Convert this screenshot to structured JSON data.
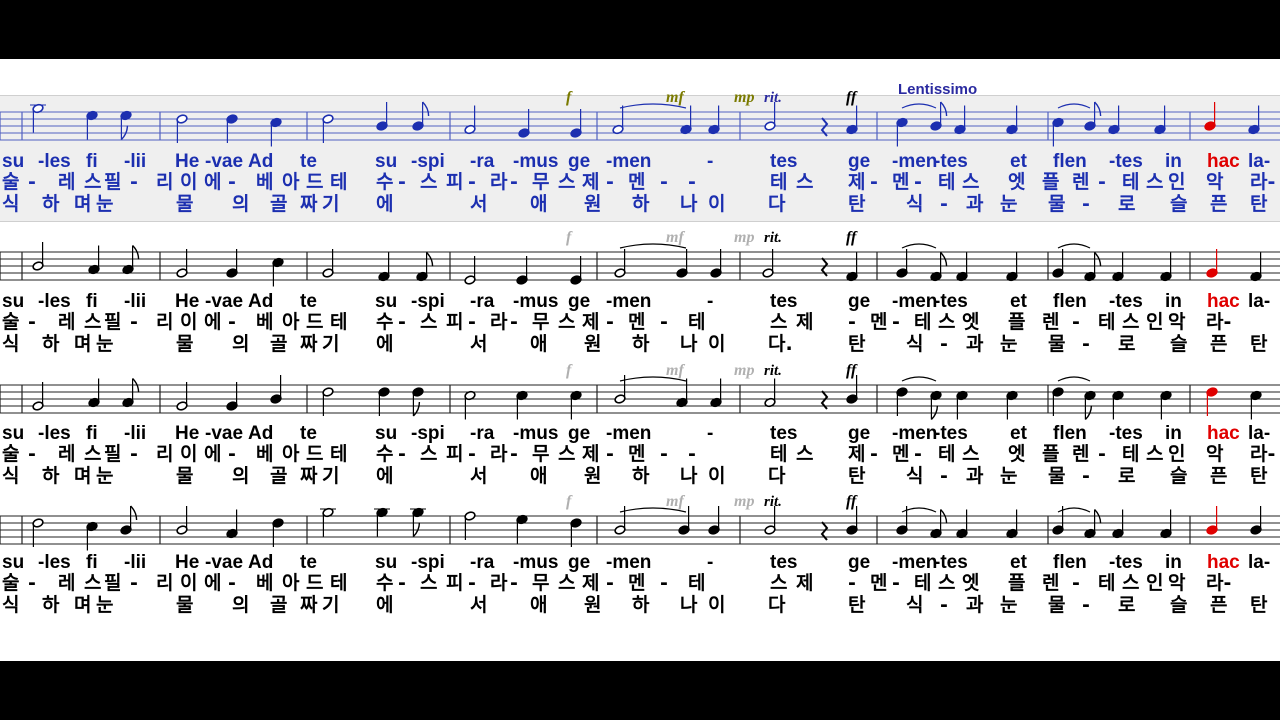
{
  "colors": {
    "active_staff": "#1c2fb0",
    "normal": "#000000",
    "current_note": "#e00000",
    "dynamic_active": "#7a7a00",
    "dynamic_inactive": "#b0b0b0",
    "tempo": "#2a2aa0"
  },
  "tempo_marking": "Lentissimo",
  "staves": [
    {
      "latin": [
        "su",
        "-les",
        "fi",
        "-lii",
        "He",
        "-vae",
        "Ad",
        "te",
        "su",
        "-spi",
        "-ra",
        "-mus",
        "ge",
        "-men",
        "-",
        "tes",
        "ge",
        "-men",
        "-tes",
        "et",
        "flen",
        "-tes",
        "in",
        "hac",
        "la-"
      ],
      "korean1": [
        "술",
        "-",
        "레",
        "스",
        "필",
        "-",
        "리",
        "이",
        "에",
        "-",
        "베",
        "아",
        "드",
        "테",
        "수",
        "-",
        "스",
        "피",
        "-",
        "라",
        "-",
        "무",
        "스",
        "제",
        "-",
        "멘",
        "-",
        "-",
        "테",
        "스",
        "제",
        "-",
        "멘",
        "-",
        "테",
        "스",
        "엣",
        "플",
        "렌",
        "-",
        "테",
        "스",
        "인",
        "악",
        "라-"
      ],
      "korean2": [
        "식",
        "하",
        "며",
        "눈",
        "물",
        "의",
        "골",
        "짜",
        "기",
        "에",
        "서",
        "애",
        "원",
        "하",
        "나",
        "이",
        "다",
        "탄",
        "식",
        "-",
        "과",
        "눈",
        "물",
        "-",
        "로",
        "슬",
        "픈",
        "탄"
      ],
      "dynamics": [
        "f",
        "mf",
        "mp",
        "rit.",
        "ff"
      ]
    },
    {
      "latin": [
        "su",
        "-les",
        "fi",
        "-lii",
        "He",
        "-vae",
        "Ad",
        "te",
        "su",
        "-spi",
        "-ra",
        "-mus",
        "ge",
        "-men",
        "-",
        "tes",
        "ge",
        "-men",
        "-tes",
        "et",
        "flen",
        "-tes",
        "in",
        "hac",
        "la-"
      ],
      "korean1": [
        "술",
        "-",
        "레",
        "스",
        "필",
        "-",
        "리",
        "이",
        "에",
        "-",
        "베",
        "아",
        "드",
        "테",
        "수",
        "-",
        "스",
        "피",
        "-",
        "라",
        "-",
        "무",
        "스",
        "제",
        "-",
        "멘",
        "-",
        "테",
        "스",
        "제",
        "-",
        "멘",
        "-",
        "테",
        "스",
        "엣",
        "플",
        "렌",
        "-",
        "테",
        "스",
        "인",
        "악",
        "라-"
      ],
      "korean2": [
        "식",
        "하",
        "며",
        "눈",
        "물",
        "의",
        "골",
        "짜",
        "기",
        "에",
        "서",
        "애",
        "원",
        "하",
        "나",
        "이",
        "다.",
        "탄",
        "식",
        "-",
        "과",
        "눈",
        "물",
        "-",
        "로",
        "슬",
        "픈",
        "탄"
      ],
      "dynamics": [
        "f",
        "mf",
        "mp",
        "rit.",
        "ff"
      ]
    },
    {
      "latin": [
        "su",
        "-les",
        "fi",
        "-lii",
        "He",
        "-vae",
        "Ad",
        "te",
        "su",
        "-spi",
        "-ra",
        "-mus",
        "ge",
        "-men",
        "-",
        "tes",
        "ge",
        "-men",
        "-tes",
        "et",
        "flen",
        "-tes",
        "in",
        "hac",
        "la-"
      ],
      "korean1": [
        "술",
        "-",
        "레",
        "스",
        "필",
        "-",
        "리",
        "이",
        "에",
        "-",
        "베",
        "아",
        "드",
        "테",
        "수",
        "-",
        "스",
        "피",
        "-",
        "라",
        "-",
        "무",
        "스",
        "제",
        "-",
        "멘",
        "-",
        "-",
        "테",
        "스",
        "제",
        "-",
        "멘",
        "-",
        "테",
        "스",
        "엣",
        "플",
        "렌",
        "-",
        "테",
        "스",
        "인",
        "악",
        "라-"
      ],
      "korean2": [
        "식",
        "하",
        "며",
        "눈",
        "물",
        "의",
        "골",
        "짜",
        "기",
        "에",
        "서",
        "애",
        "원",
        "하",
        "나",
        "이",
        "다",
        "탄",
        "식",
        "-",
        "과",
        "눈",
        "물",
        "-",
        "로",
        "슬",
        "픈",
        "탄"
      ],
      "dynamics": [
        "f",
        "mf",
        "mp",
        "rit.",
        "ff"
      ]
    },
    {
      "latin": [
        "su",
        "-les",
        "fi",
        "-lii",
        "He",
        "-vae",
        "Ad",
        "te",
        "su",
        "-spi",
        "-ra",
        "-mus",
        "ge",
        "-men",
        "-",
        "tes",
        "ge",
        "-men",
        "-tes",
        "et",
        "flen",
        "-tes",
        "in",
        "hac",
        "la-"
      ],
      "korean1": [
        "술",
        "-",
        "레",
        "스",
        "필",
        "-",
        "리",
        "이",
        "에",
        "-",
        "베",
        "아",
        "드",
        "테",
        "수",
        "-",
        "스",
        "피",
        "-",
        "라",
        "-",
        "무",
        "스",
        "제",
        "-",
        "멘",
        "-",
        "테",
        "스",
        "제",
        "-",
        "멘",
        "-",
        "테",
        "스",
        "엣",
        "플",
        "렌",
        "-",
        "테",
        "스",
        "인",
        "악",
        "라-"
      ],
      "korean2": [
        "식",
        "하",
        "며",
        "눈",
        "물",
        "의",
        "골",
        "짜",
        "기",
        "에",
        "서",
        "애",
        "원",
        "하",
        "나",
        "이",
        "다",
        "탄",
        "식",
        "-",
        "과",
        "눈",
        "물",
        "-",
        "로",
        "슬",
        "픈",
        "탄"
      ],
      "dynamics": [
        "f",
        "mf",
        "mp",
        "rit.",
        "ff"
      ]
    }
  ],
  "current_syllable": "hac"
}
